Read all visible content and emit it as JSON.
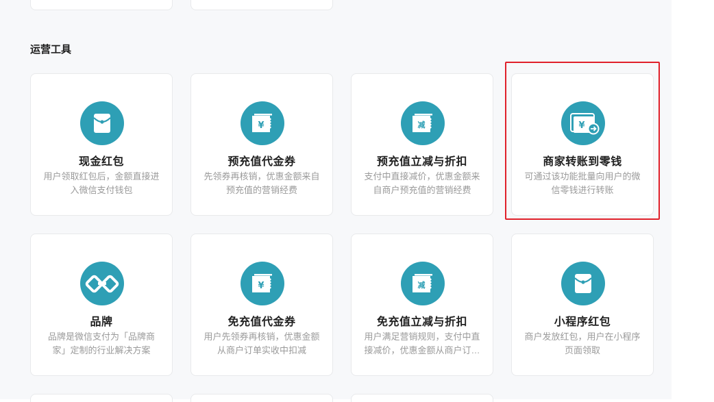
{
  "section": {
    "title": "运营工具"
  },
  "row1": [
    {
      "title": "现金红包",
      "desc": "用户领取红包后，金额直接进入微信支付钱包",
      "icon": "red-envelope-icon"
    },
    {
      "title": "预充值代金券",
      "desc": "先领券再核销，优惠金额来自预充值的营销经费",
      "icon": "yen-voucher-icon"
    },
    {
      "title": "预充值立减与折扣",
      "desc": "支付中直接减价，优惠金额来自商户预充值的营销经费",
      "icon": "discount-ticket-icon"
    },
    {
      "title": "商家转账到零钱",
      "desc": "可通过该功能批量向用户的微信零钱进行转账",
      "icon": "transfer-money-icon"
    }
  ],
  "row2": [
    {
      "title": "品牌",
      "desc": "品牌是微信支付为「品牌商家」定制的行业解决方案",
      "icon": "brand-link-icon"
    },
    {
      "title": "免充值代金券",
      "desc": "用户先领券再核销，优惠金额从商户订单实收中扣减",
      "icon": "yen-voucher-icon"
    },
    {
      "title": "免充值立减与折扣",
      "desc": "用户满足营销规则，支付中直接减价，优惠金额从商户订单实收中扣减",
      "icon": "discount-ticket-icon"
    },
    {
      "title": "小程序红包",
      "desc": "商户发放红包，用户在小程序页面领取",
      "icon": "red-envelope-icon"
    }
  ],
  "icon_glyphs": {
    "yen": "¥",
    "discount": "减"
  },
  "colors": {
    "accent": "#2e9fb5",
    "highlight": "#e0202a"
  }
}
